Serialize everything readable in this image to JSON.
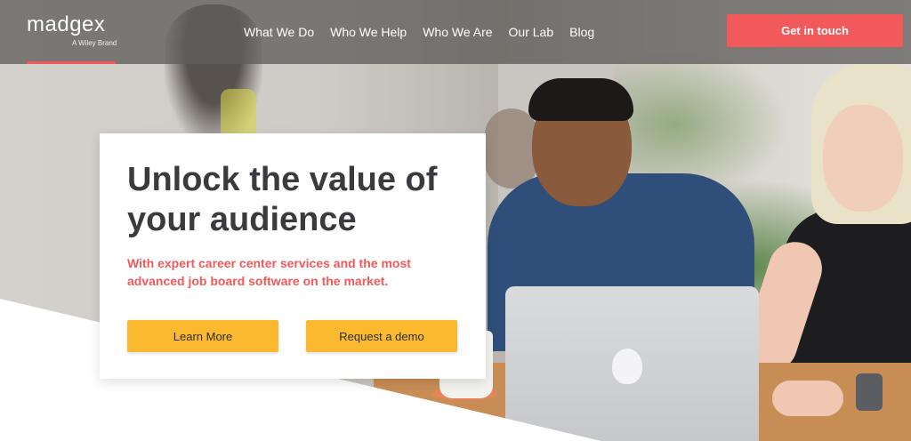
{
  "header": {
    "logo_text": "madgex",
    "logo_subtext": "A Wiley Brand",
    "nav": [
      {
        "label": "What We Do"
      },
      {
        "label": "Who We Help"
      },
      {
        "label": "Who We Are"
      },
      {
        "label": "Our Lab"
      },
      {
        "label": "Blog"
      }
    ],
    "cta_label": "Get in touch"
  },
  "hero": {
    "headline": "Unlock the value of your audience",
    "subheadline": "With expert career center services and the most advanced job board software on the market.",
    "buttons": {
      "learn_more": "Learn More",
      "request_demo": "Request a demo"
    }
  },
  "colors": {
    "accent": "#f1595a",
    "button_yellow": "#fbb930",
    "header_overlay": "#605d5b",
    "headline_text": "#3b3b3f"
  },
  "icons": {
    "laptop_logo": "apple-logo-icon"
  }
}
